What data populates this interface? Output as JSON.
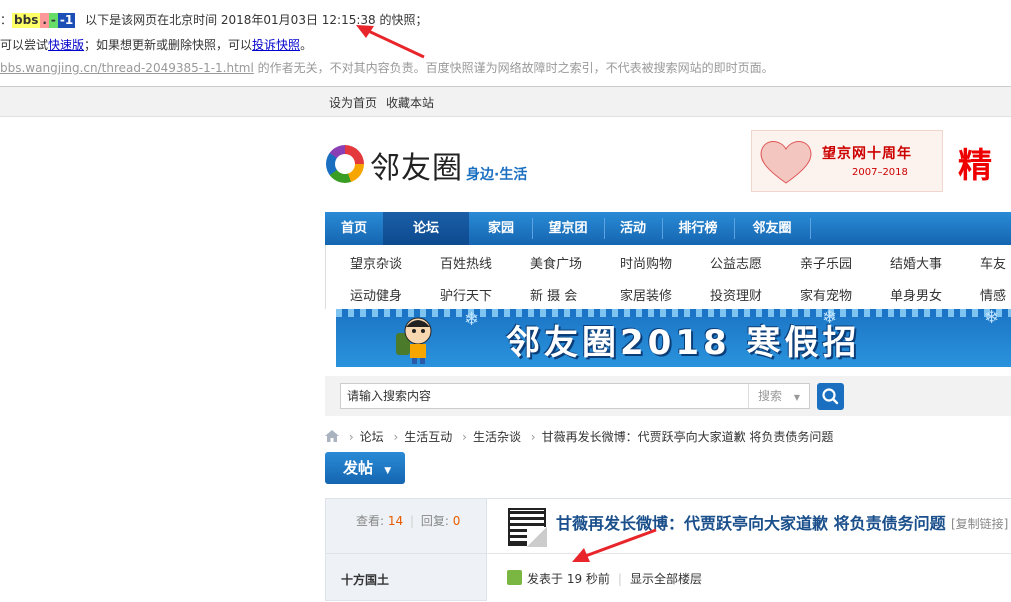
{
  "snapshot": {
    "prefix": "：",
    "term1": "bbs",
    "term2": ".",
    "term3": "-",
    "term4": "-1",
    "line1_text": "以下是该网页在北京时间 2018年01月03日 12:15:38 的快照；",
    "line2_pre": "可以尝试",
    "line2_link1": "快速版",
    "line2_mid": "；如果想更新或删除快照，可以",
    "line2_link2": "投诉快照",
    "line2_end": "。",
    "line3_url": "bbs.wangjing.cn/thread-2049385-1-1.html",
    "line3_text": " 的作者无关，不对其内容负责。百度快照谨为网络故障时之索引，不代表被搜索网站的即时页面。"
  },
  "topbar": {
    "home": "设为首页",
    "fav": "收藏本站"
  },
  "logo": {
    "name": "邻友圈",
    "sub": "身边·生活"
  },
  "anniversary": {
    "title": "望京网十周年",
    "years": "2007–2018",
    "side": "精"
  },
  "nav": {
    "items": [
      "首页",
      "论坛",
      "家园",
      "望京团",
      "活动",
      "排行榜",
      "邻友圈"
    ]
  },
  "subnav": {
    "row1": [
      "望京杂谈",
      "百姓热线",
      "美食广场",
      "时尚购物",
      "公益志愿",
      "亲子乐园",
      "结婚大事",
      "车友"
    ],
    "row2": [
      "运动健身",
      "驴行天下",
      "新 摄 会",
      "家居装修",
      "投资理财",
      "家有宠物",
      "单身男女",
      "情感"
    ]
  },
  "banner": {
    "text": "邻友圈2018  寒假招"
  },
  "search": {
    "placeholder": "请输入搜索内容",
    "type": "搜索"
  },
  "breadcrumb": [
    "论坛",
    "生活互动",
    "生活杂谈",
    "甘薇再发长微博：代贾跃亭向大家道歉 将负责债务问题"
  ],
  "post_button": "发帖",
  "thread": {
    "views_label": "查看:",
    "views": "14",
    "replies_label": "回复:",
    "replies": "0",
    "author": "十方国土",
    "title": "甘薇再发长微博：代贾跃亭向大家道歉 将负责债务问题",
    "copy_link": "[复制链接]",
    "posted": "发表于 19 秒前",
    "show_all": "显示全部楼层"
  },
  "colors": {
    "nav_blue": "#1a6fc1",
    "arrow_red": "#e8252a",
    "highlight_yellow": "#ffff66",
    "highlight_blue": "#1c4fb5"
  }
}
